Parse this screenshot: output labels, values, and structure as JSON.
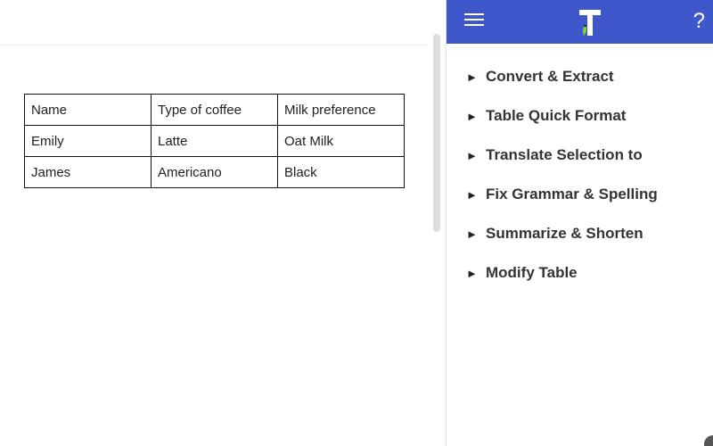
{
  "table": {
    "rows": [
      [
        "Name",
        "Type of coffee",
        "Milk preference"
      ],
      [
        "Emily",
        "Latte",
        "Oat Milk"
      ],
      [
        "James",
        "Americano",
        "Black"
      ]
    ]
  },
  "sidebar": {
    "header": {
      "background": "#3e58cc",
      "menu_icon": "hamburger-icon",
      "logo_letter": "T",
      "help_label": "?"
    },
    "menu": [
      {
        "label": "Convert & Extract",
        "icon": "triangle-right-icon"
      },
      {
        "label": "Table Quick Format",
        "icon": "triangle-right-icon"
      },
      {
        "label": "Translate Selection to",
        "icon": "triangle-right-icon"
      },
      {
        "label": "Fix Grammar & Spelling",
        "icon": "triangle-right-icon"
      },
      {
        "label": "Summarize & Shorten",
        "icon": "triangle-right-icon"
      },
      {
        "label": "Modify Table",
        "icon": "triangle-right-icon"
      }
    ]
  }
}
